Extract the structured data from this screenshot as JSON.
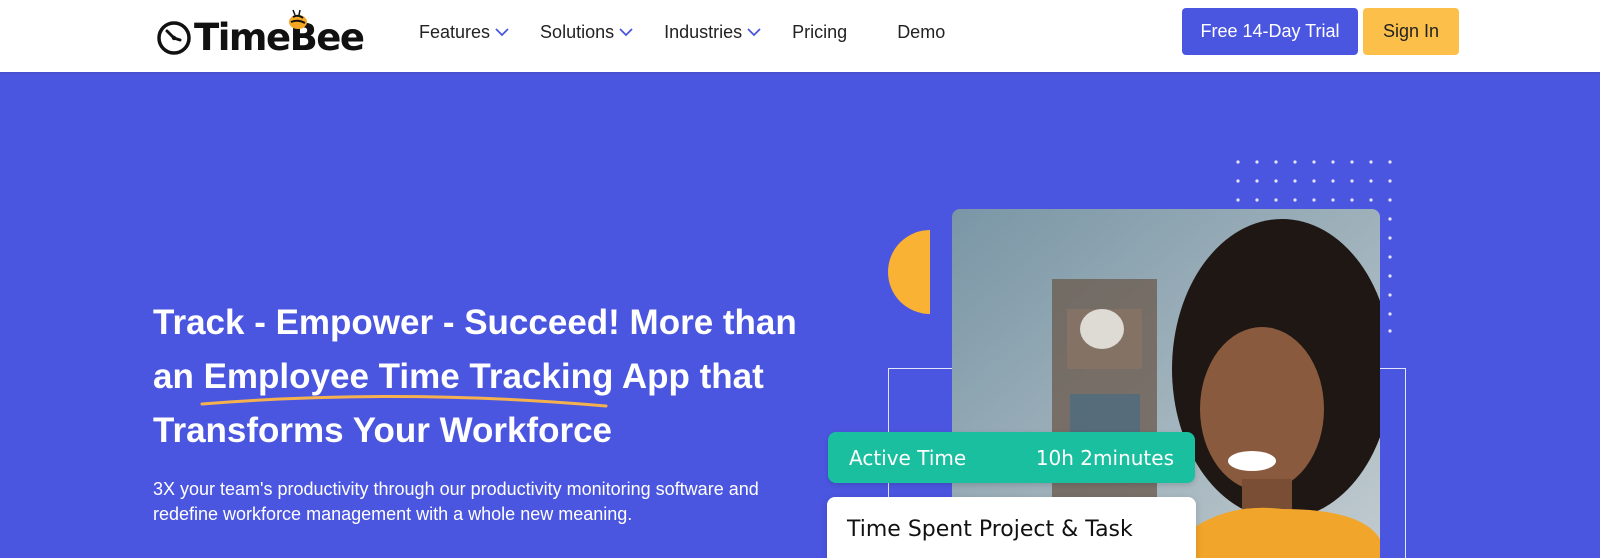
{
  "brand": {
    "name_part1": "Time",
    "name_part2": "Bee",
    "logo_icon": "clock-bee-logo"
  },
  "nav": {
    "items": [
      {
        "label": "Features",
        "has_dropdown": true
      },
      {
        "label": "Solutions",
        "has_dropdown": true
      },
      {
        "label": "Industries",
        "has_dropdown": true
      },
      {
        "label": "Pricing",
        "has_dropdown": false
      },
      {
        "label": "Demo",
        "has_dropdown": false
      }
    ]
  },
  "header": {
    "trial_label": "Free 14-Day Trial",
    "signin_label": "Sign In"
  },
  "hero": {
    "headline_line1": "Track - Empower - Succeed! More than",
    "headline_line2_pre": "an ",
    "headline_line2_highlight": "Employee Time Tracking",
    "headline_line2_post": " App that",
    "headline_line3": "Transforms Your Workforce",
    "subtext_line1": "3X your team's productivity through our productivity monitoring software and",
    "subtext_line2": "redefine workforce management with a whole new meaning."
  },
  "cards": {
    "active_time_label": "Active Time",
    "active_time_value": "10h 2minutes",
    "time_spent_title": "Time Spent Project & Task"
  },
  "colors": {
    "accent": "#4b56e0",
    "signin": "#fcbf49",
    "active_card": "#19bf9e",
    "underline": "#f5b14d"
  }
}
